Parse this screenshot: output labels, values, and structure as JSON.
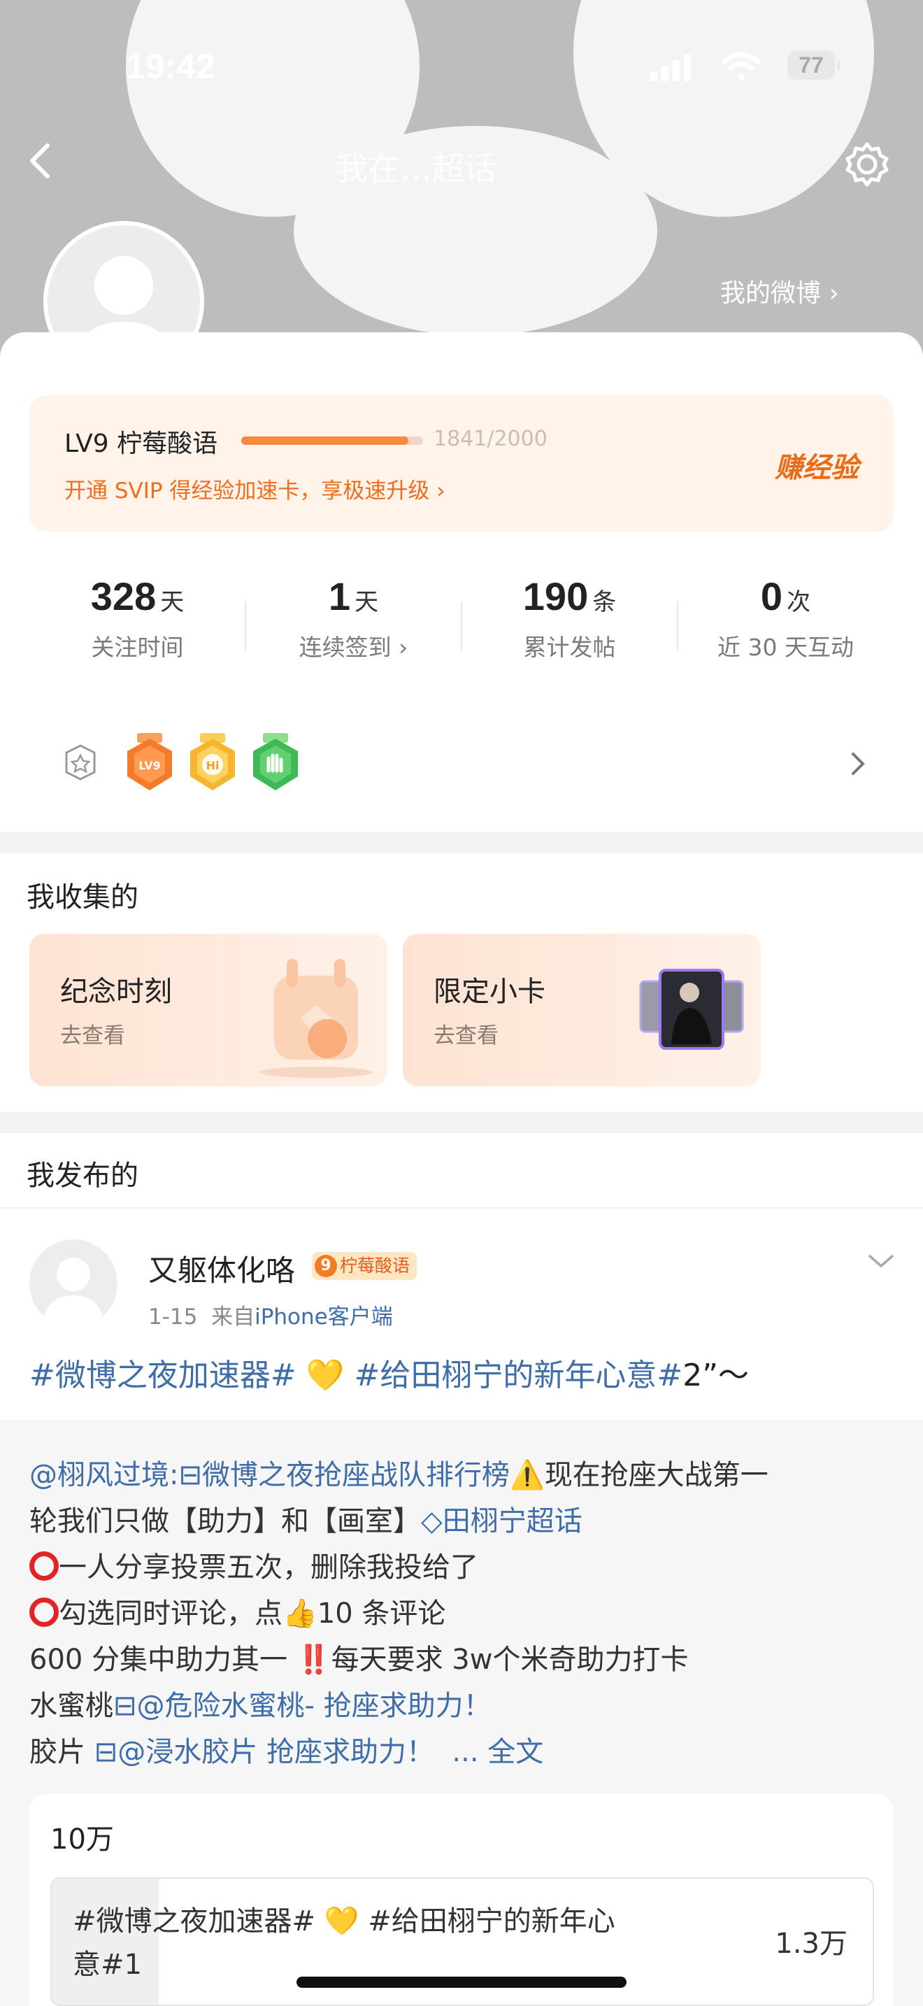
{
  "status_bar": {
    "time": "19:42",
    "battery": "77"
  },
  "nav": {
    "title": "我在…超话"
  },
  "profile": {
    "my_weibo": "我的微博 ›"
  },
  "level": {
    "name": "LV9 柠莓酸语",
    "progress_text": "1841/2000",
    "progress_fraction": 0.92,
    "promo": "开通 SVIP 得经验加速卡，享极速升级 ›",
    "earn_label": "赚经验",
    "accent": "#f58a3f"
  },
  "stats": [
    {
      "num": "328",
      "unit": "天",
      "label": "关注时间"
    },
    {
      "num": "1",
      "unit": "天",
      "label": "连续签到 ›"
    },
    {
      "num": "190",
      "unit": "条",
      "label": "累计发帖"
    },
    {
      "num": "0",
      "unit": "次",
      "label": "近 30 天互动"
    }
  ],
  "badges": {
    "first": "LV9",
    "second": "Hi"
  },
  "collected": {
    "title": "我收集的",
    "cards": [
      {
        "title": "纪念时刻",
        "sub": "去查看"
      },
      {
        "title": "限定小卡",
        "sub": "去查看"
      }
    ]
  },
  "published": {
    "title": "我发布的"
  },
  "post": {
    "author": "又躯体化咯",
    "badge_level": "9",
    "badge_text": "柠莓酸语",
    "date": "1-15",
    "from_prefix": "来自",
    "source": "iPhone客户端",
    "text_tag1": "#微博之夜加速器#",
    "text_heart": "💛",
    "text_tag2": "#给田栩宁的新年心意#",
    "text_tail": "2”～"
  },
  "repost": {
    "line1_mention": "@栩风过境:",
    "line1_link": "微博之夜抢座战队排行榜",
    "line1_warn": "⚠️",
    "line1_tail": "现在抢座大战第一",
    "line2_a": "轮我们只做【助力】和【画室】",
    "line2_link": "田栩宁超话",
    "line3": "一人分享投票五次，删除我投给了",
    "line4_a": "勾选同时评论，点",
    "line4_thumb": "👍",
    "line4_b": "10 条评论",
    "line5_a": "600 分集中助力其一 ",
    "line5_bang": "‼️",
    "line5_b": "每天要求 3w个米奇助力打卡",
    "line6_a": "水蜜桃",
    "line6_link": "@危险水蜜桃- 抢座求助力！",
    "line7_a": "胶片 ",
    "line7_link": "@浸水胶片 抢座求助力！",
    "line7_more": "... 全文"
  },
  "poll": {
    "total": "10万",
    "option_text_1": "#微博之夜加速器# 💛 #给田栩宁的新年心",
    "option_text_2": "意#1",
    "option_count": "1.3万",
    "option_fraction": 0.13
  }
}
